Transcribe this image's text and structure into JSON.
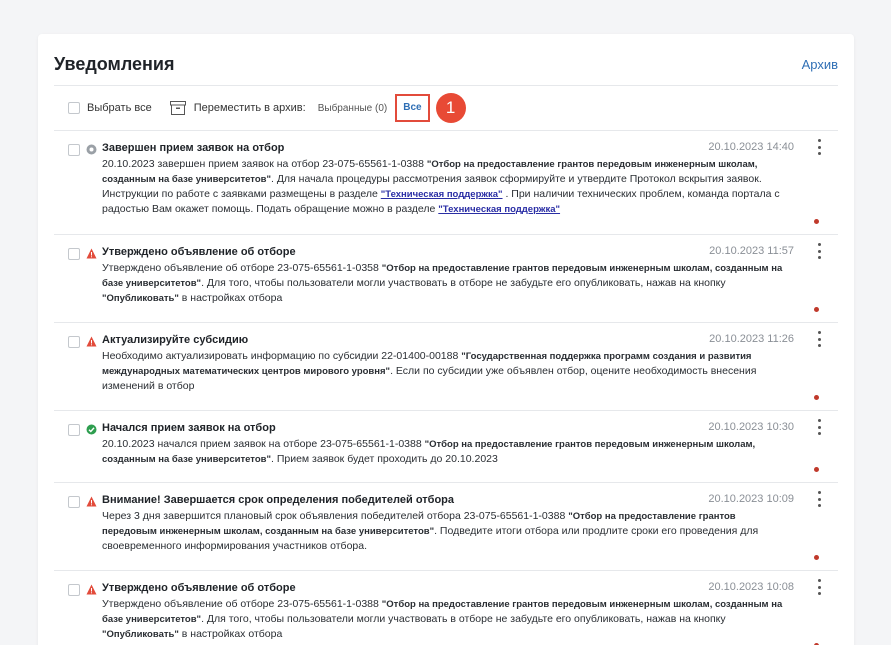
{
  "header": {
    "title": "Уведомления",
    "archive_label": "Архив"
  },
  "toolbar": {
    "select_all_label": "Выбрать все",
    "move_archive_label": "Переместить в архив:",
    "selected_label": "Выбранные (0)",
    "all_label": "Все",
    "step_number": "1"
  },
  "colors": {
    "accent": "#2f6fb5",
    "highlight": "#e24b3b",
    "warning": "#e24b3b",
    "success": "#2e9e4f",
    "neutral": "#9aa0a6"
  },
  "notifications": [
    {
      "status": "neutral-icon",
      "title": "Завершен прием заявок на отбор",
      "date": "20.10.2023 14:40",
      "t1": "20.10.2023 завершен прием заявок на отбор 23-075-65561-1-0388 ",
      "b1": "\"Отбор на предоставление грантов передовым инженерным школам, созданным на базе университетов\"",
      "t2": ". Для начала процедуры рассмотрения заявок сформируйте и утвердите Протокол вскрытия заявок. Инструкции по работе с заявками размещены в разделе ",
      "link1": "\"Техническая поддержка\"",
      "t3": " . При наличии технических проблем, команда портала с радостью Вам окажет помощь. Подать обращение можно в разделе ",
      "link2": "\"Техническая поддержка\""
    },
    {
      "status": "warning-icon",
      "title": "Утверждено объявление об отборе",
      "date": "20.10.2023 11:57",
      "t1": "Утверждено объявление об отборе 23-075-65561-1-0358 ",
      "b1": "\"Отбор на предоставление грантов передовым инженерным школам, созданным на базе университетов\"",
      "t2": ". Для того, чтобы пользователи могли участвовать в отборе не забудьте его опубликовать, нажав на кнопку ",
      "b2": "\"Опубликовать\"",
      "t3": " в настройках отбора"
    },
    {
      "status": "warning-icon",
      "title": "Актуализируйте субсидию",
      "date": "20.10.2023 11:26",
      "t1": "Необходимо актуализировать информацию по субсидии 22-01400-00188 ",
      "b1": "\"Государственная поддержка программ создания и развития международных математических центров мирового уровня\"",
      "t2": ". Если по субсидии уже объявлен отбор, оцените необходимость внесения изменений в отбор"
    },
    {
      "status": "success-icon",
      "title": "Начался прием заявок на отбор",
      "date": "20.10.2023 10:30",
      "t1": "20.10.2023 начался прием заявок на отборе 23-075-65561-1-0388 ",
      "b1": "\"Отбор на предоставление грантов передовым инженерным школам, созданным на базе университетов\"",
      "t2": ". Прием заявок будет проходить до 20.10.2023"
    },
    {
      "status": "warning-icon",
      "title": "Внимание! Завершается срок определения победителей отбора",
      "date": "20.10.2023 10:09",
      "t1": "Через 3 дня завершится плановый срок объявления победителей отбора 23-075-65561-1-0388 ",
      "b1": "\"Отбор на предоставление грантов передовым инженерным школам, созданным на базе университетов\"",
      "t2": ". Подведите итоги отбора или продлите сроки его проведения для своевременного информирования участников отбора."
    },
    {
      "status": "warning-icon",
      "title": "Утверждено объявление об отборе",
      "date": "20.10.2023 10:08",
      "t1": "Утверждено объявление об отборе 23-075-65561-1-0388 ",
      "b1": "\"Отбор на предоставление грантов передовым инженерным школам, созданным на базе университетов\"",
      "t2": ". Для того, чтобы пользователи могли участвовать в отборе не забудьте его опубликовать, нажав на кнопку ",
      "b2": "\"Опубликовать\"",
      "t3": " в настройках отбора"
    }
  ]
}
